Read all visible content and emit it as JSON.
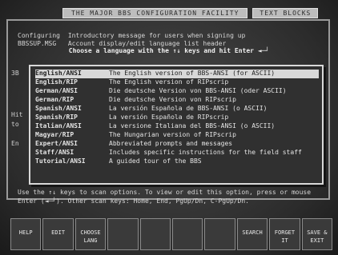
{
  "title": "THE MAJOR BBS CONFIGURATION FACILITY",
  "title_right": "TEXT BLOCKS",
  "header": {
    "row1_key": "Configuring",
    "row1_value": "Introductory message for users when signing up",
    "row2_key": "BBSSUP.MSG",
    "row2_value": "Account display/edit language list header"
  },
  "left_labels": [
    "3B",
    "Hit",
    "to",
    "En"
  ],
  "prompt": "Choose a language with the ↑↓ keys and hit Enter ◄─┘",
  "languages": [
    {
      "name": "English/ANSI",
      "desc": "The English version of BBS-ANSI (for ASCII)",
      "selected": true
    },
    {
      "name": "English/RIP",
      "desc": "The English version of RIPscrip",
      "selected": false
    },
    {
      "name": "German/ANSI",
      "desc": "Die deutsche Version von BBS-ANSI (oder ASCII)",
      "selected": false
    },
    {
      "name": "German/RIP",
      "desc": "Die deutsche Version von RIPscrip",
      "selected": false
    },
    {
      "name": "Spanish/ANSI",
      "desc": "La versión Española de BBS-ANSI (o ASCII)",
      "selected": false
    },
    {
      "name": "Spanish/RIP",
      "desc": "La versión Española de RIPscrip",
      "selected": false
    },
    {
      "name": "Italian/ANSI",
      "desc": "La versione Italiana del BBS-ANSI (o ASCII)",
      "selected": false
    },
    {
      "name": "Magyar/RIP",
      "desc": "The Hungarian version of RIPscrip",
      "selected": false
    },
    {
      "name": "Expert/ANSI",
      "desc": "Abbreviated prompts and messages",
      "selected": false
    },
    {
      "name": "Staff/ANSI",
      "desc": "Includes specific instructions for the field staff",
      "selected": false
    },
    {
      "name": "Tutorial/ANSI",
      "desc": "A guided tour of the BBS",
      "selected": false
    }
  ],
  "help_line1": "Use the ↑↓ keys to scan options. To view or edit this option, press or mouse",
  "help_line2": "Enter (◄─┘).  Other scan keys: Home, End, PgUp/Dn, C-PgUp/Dn.",
  "fkeys": [
    {
      "label1": "HELP",
      "label2": ""
    },
    {
      "label1": "EDIT",
      "label2": ""
    },
    {
      "label1": "CHOOSE",
      "label2": "LANG"
    },
    {
      "label1": "",
      "label2": ""
    },
    {
      "label1": "",
      "label2": ""
    },
    {
      "label1": "",
      "label2": ""
    },
    {
      "label1": "",
      "label2": ""
    },
    {
      "label1": "SEARCH",
      "label2": ""
    },
    {
      "label1": "FORGET",
      "label2": "IT"
    },
    {
      "label1": "SAVE &",
      "label2": "EXIT"
    }
  ]
}
